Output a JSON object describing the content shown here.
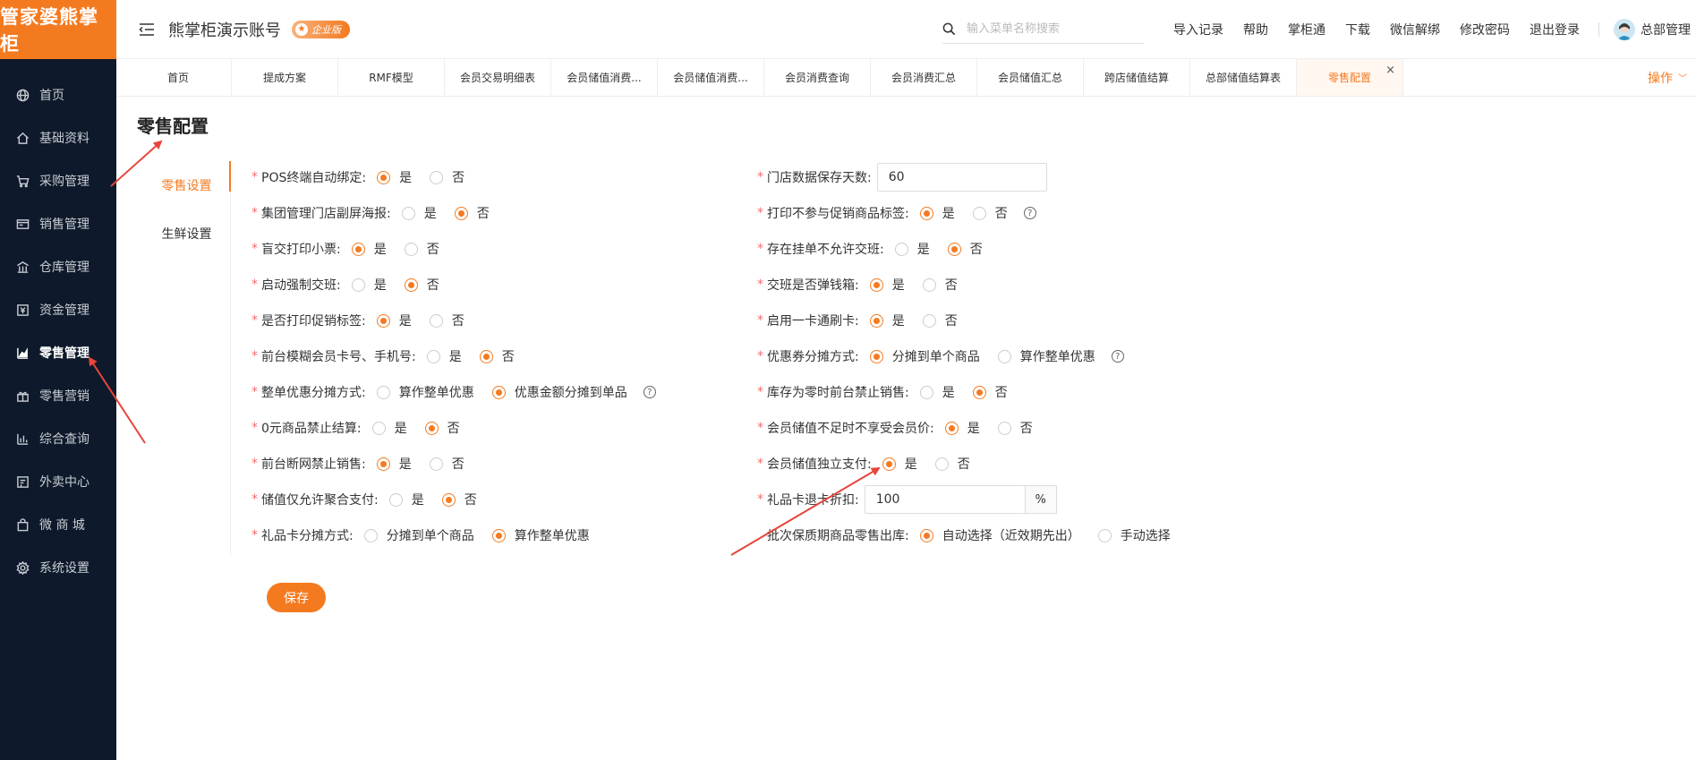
{
  "app": {
    "logo_text": "管家婆熊掌柜",
    "account_title": "熊掌柜演示账号",
    "edition_badge": "企业版"
  },
  "sidebar": {
    "items": [
      {
        "label": "首页",
        "icon": "globe-icon"
      },
      {
        "label": "基础资料",
        "icon": "home-icon"
      },
      {
        "label": "采购管理",
        "icon": "cart-icon"
      },
      {
        "label": "销售管理",
        "icon": "sales-icon"
      },
      {
        "label": "仓库管理",
        "icon": "warehouse-icon"
      },
      {
        "label": "资金管理",
        "icon": "money-icon"
      },
      {
        "label": "零售管理",
        "icon": "chart-icon"
      },
      {
        "label": "零售营销",
        "icon": "gift-icon"
      },
      {
        "label": "综合查询",
        "icon": "bar-chart-icon"
      },
      {
        "label": "外卖中心",
        "icon": "delivery-icon"
      },
      {
        "label": "微 商 城",
        "icon": "bag-icon"
      },
      {
        "label": "系统设置",
        "icon": "gear-icon"
      }
    ],
    "active_index": 6
  },
  "header": {
    "search_placeholder": "输入菜单名称搜索",
    "links": [
      "导入记录",
      "帮助",
      "掌柜通",
      "下载",
      "微信解绑",
      "修改密码",
      "退出登录"
    ],
    "user_name": "总部管理"
  },
  "tabs": {
    "items": [
      "首页",
      "提成方案",
      "RMF模型",
      "会员交易明细表",
      "会员储值消费...",
      "会员储值消费...",
      "会员消费查询",
      "会员消费汇总",
      "会员储值汇总",
      "跨店储值结算",
      "总部储值结算表",
      "零售配置"
    ],
    "active_index": 11,
    "close_symbol": "×",
    "operations_label": "操作"
  },
  "page": {
    "title": "零售配置",
    "subnav": [
      "零售设置",
      "生鲜设置"
    ],
    "subnav_active": 0,
    "yes": "是",
    "no": "否",
    "save_label": "保存"
  },
  "form": {
    "left": [
      {
        "label": "POS终端自动绑定:",
        "options": [
          "是",
          "否"
        ],
        "selected": 0,
        "required": true
      },
      {
        "label": "集团管理门店副屏海报:",
        "options": [
          "是",
          "否"
        ],
        "selected": 1,
        "required": true
      },
      {
        "label": "盲交打印小票:",
        "options": [
          "是",
          "否"
        ],
        "selected": 0,
        "required": true
      },
      {
        "label": "启动强制交班:",
        "options": [
          "是",
          "否"
        ],
        "selected": 1,
        "required": true
      },
      {
        "label": "是否打印促销标签:",
        "options": [
          "是",
          "否"
        ],
        "selected": 0,
        "required": true
      },
      {
        "label": "前台模糊会员卡号、手机号:",
        "options": [
          "是",
          "否"
        ],
        "selected": 1,
        "required": true
      },
      {
        "label": "整单优惠分摊方式:",
        "options": [
          "算作整单优惠",
          "优惠金额分摊到单品"
        ],
        "selected": 1,
        "required": true,
        "help": true
      },
      {
        "label": "0元商品禁止结算:",
        "options": [
          "是",
          "否"
        ],
        "selected": 1,
        "required": true
      },
      {
        "label": "前台断网禁止销售:",
        "options": [
          "是",
          "否"
        ],
        "selected": 0,
        "required": true
      },
      {
        "label": "储值仅允许聚合支付:",
        "options": [
          "是",
          "否"
        ],
        "selected": 1,
        "required": true
      },
      {
        "label": "礼品卡分摊方式:",
        "options": [
          "分摊到单个商品",
          "算作整单优惠"
        ],
        "selected": 1,
        "required": true
      }
    ],
    "right": [
      {
        "label": "门店数据保存天数:",
        "type": "input",
        "value": "60",
        "required": true
      },
      {
        "label": "打印不参与促销商品标签:",
        "options": [
          "是",
          "否"
        ],
        "selected": 0,
        "required": true,
        "help": true
      },
      {
        "label": "存在挂单不允许交班:",
        "options": [
          "是",
          "否"
        ],
        "selected": 1,
        "required": true
      },
      {
        "label": "交班是否弹钱箱:",
        "options": [
          "是",
          "否"
        ],
        "selected": 0,
        "required": true
      },
      {
        "label": "启用一卡通刷卡:",
        "options": [
          "是",
          "否"
        ],
        "selected": 0,
        "required": true
      },
      {
        "label": "优惠券分摊方式:",
        "options": [
          "分摊到单个商品",
          "算作整单优惠"
        ],
        "selected": 0,
        "required": true,
        "help": true
      },
      {
        "label": "库存为零时前台禁止销售:",
        "options": [
          "是",
          "否"
        ],
        "selected": 1,
        "required": true
      },
      {
        "label": "会员储值不足时不享受会员价:",
        "options": [
          "是",
          "否"
        ],
        "selected": 0,
        "required": true
      },
      {
        "label": "会员储值独立支付:",
        "options": [
          "是",
          "否"
        ],
        "selected": 0,
        "required": true
      },
      {
        "label": "礼品卡退卡折扣:",
        "type": "input-addon",
        "value": "100",
        "addon": "%",
        "required": true
      },
      {
        "label": "批次保质期商品零售出库:",
        "options": [
          "自动选择（近效期先出）",
          "手动选择"
        ],
        "selected": 0,
        "required": false
      }
    ]
  },
  "colors": {
    "accent": "#f47a20",
    "sidebar_bg": "#0e1a2b",
    "arrow": "#e8453c"
  }
}
